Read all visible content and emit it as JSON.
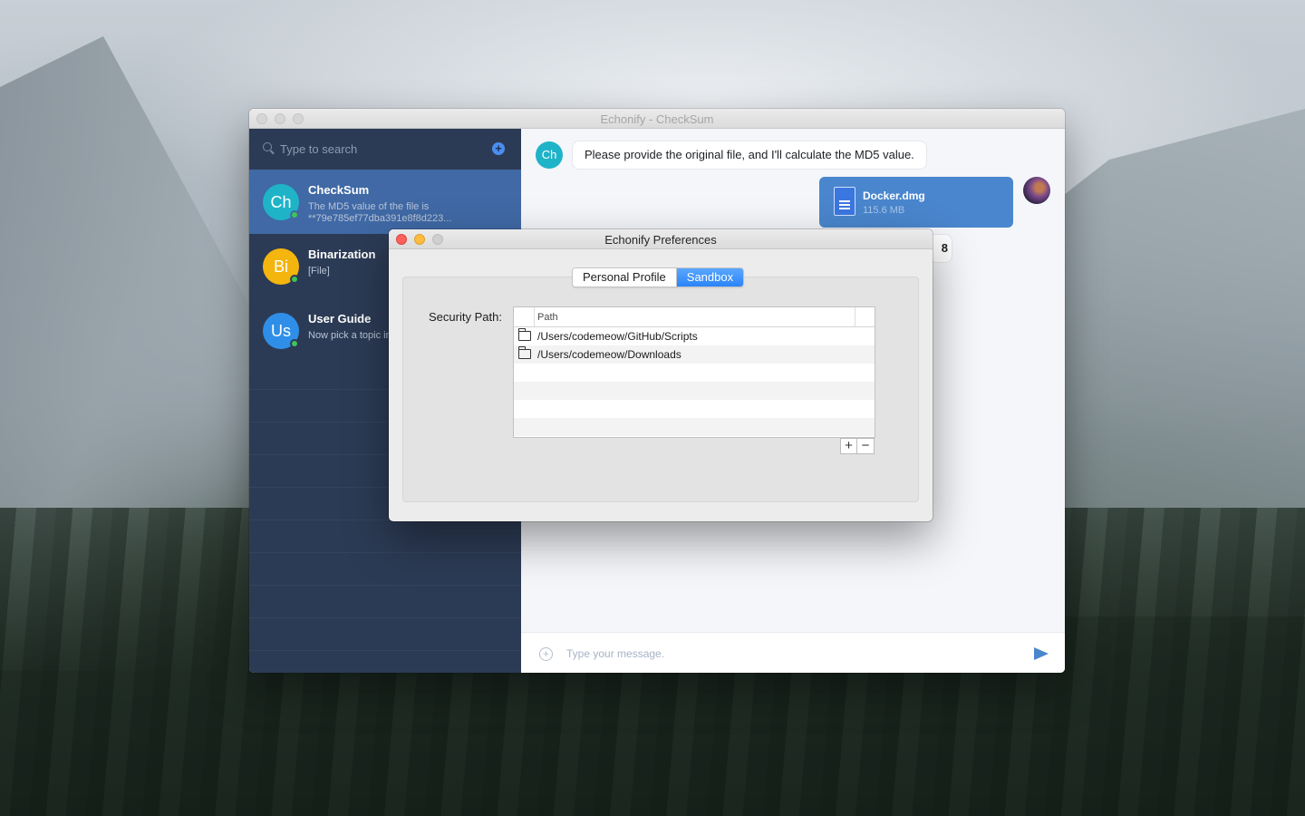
{
  "main_window": {
    "title": "Echonify - CheckSum",
    "sidebar": {
      "search_placeholder": "Type to search",
      "add_icon": "plus-circle-icon",
      "chats": [
        {
          "initials": "Ch",
          "name": "CheckSum",
          "preview": "The MD5 value of the file is **79e785ef77dba391e8f8d223...",
          "avatar_color": "#1fb3c8",
          "online": true,
          "selected": true
        },
        {
          "initials": "Bi",
          "name": "Binarization",
          "preview": "[File]",
          "avatar_color": "#f5b50f",
          "online": true,
          "selected": false
        },
        {
          "initials": "Us",
          "name": "User Guide",
          "preview": "Now pick a topic interested in (Typ",
          "avatar_color": "#2f8fe8",
          "online": true,
          "selected": false
        }
      ]
    },
    "conversation": {
      "bot_initials": "Ch",
      "incoming_message": "Please provide the original file, and I'll calculate the MD5 value.",
      "file_message": {
        "name": "Docker.dmg",
        "size": "115.6 MB",
        "icon": "document-icon"
      },
      "partially_hidden_text": "8"
    },
    "composer": {
      "placeholder": "Type your message.",
      "attach_icon": "plus-circle-icon",
      "send_icon": "send-icon"
    }
  },
  "prefs_window": {
    "title": "Echonify Preferences",
    "tabs": [
      "Personal Profile",
      "Sandbox"
    ],
    "active_tab": "Sandbox",
    "security_path_label": "Security Path:",
    "table": {
      "header": "Path",
      "rows": [
        {
          "icon": "folder-icon",
          "path": "/Users/codemeow/GitHub/Scripts"
        },
        {
          "icon": "folder-icon",
          "path": "/Users/codemeow/Downloads"
        }
      ]
    },
    "add_label": "+",
    "remove_label": "−"
  },
  "colors": {
    "sidebar_bg": "#2c3b55",
    "sidebar_selected": "#4069a5",
    "accent_blue": "#2a84f8",
    "file_bubble": "#4a86cd"
  }
}
